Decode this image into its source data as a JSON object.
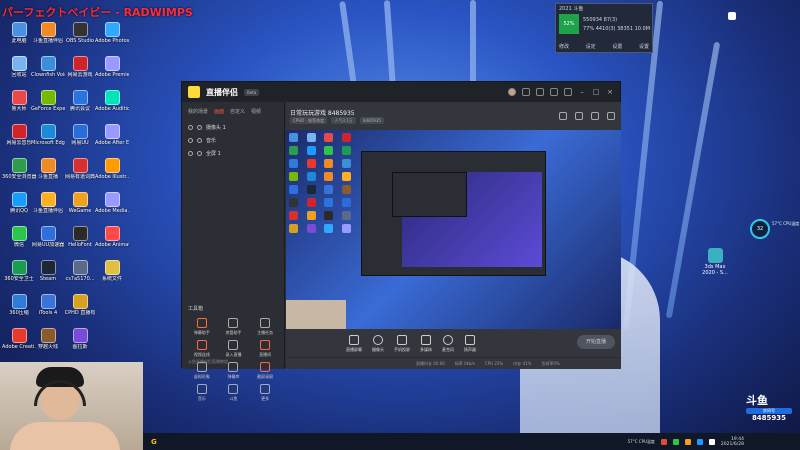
{
  "stream_title": "パーフェクトベイビー - RADWIMPS",
  "desktop_icons_col1": [
    {
      "label": "此电脑",
      "color": "#4a90e2"
    },
    {
      "label": "回收站",
      "color": "#7ab4f0"
    },
    {
      "label": "鲁大师",
      "color": "#e84a4a"
    },
    {
      "label": "网易云音乐",
      "color": "#d0242c"
    },
    {
      "label": "360安全浏览器",
      "color": "#2e9d4b"
    },
    {
      "label": "腾讯QQ",
      "color": "#1a9bff"
    },
    {
      "label": "微信",
      "color": "#2ac54a"
    },
    {
      "label": "360安全卫士",
      "color": "#1c9c50"
    },
    {
      "label": "360压缩",
      "color": "#2f7bd8"
    },
    {
      "label": "Adobe Creati...",
      "color": "#e53a2c"
    }
  ],
  "desktop_icons_col2": [
    {
      "label": "斗鱼直播伴侣",
      "color": "#f08a24"
    },
    {
      "label": "Clownfish Voice...",
      "color": "#3a8fd8"
    },
    {
      "label": "GeForce Experience",
      "color": "#76b900"
    },
    {
      "label": "Microsoft Edge",
      "color": "#1c8ad8"
    },
    {
      "label": "斗鱼直播",
      "color": "#f08a24"
    },
    {
      "label": "斗鱼直播伴侣",
      "color": "#ffb020"
    },
    {
      "label": "网易UU加速器",
      "color": "#2e6fdc"
    },
    {
      "label": "Steam",
      "color": "#1b2838"
    },
    {
      "label": "iTools 4",
      "color": "#3a73d8"
    },
    {
      "label": "穿越火线",
      "color": "#8a5b2c"
    }
  ],
  "desktop_icons_col3": [
    {
      "label": "OBS Studio",
      "color": "#333333"
    },
    {
      "label": "网易云游戏",
      "color": "#d0242c"
    },
    {
      "label": "腾讯会议",
      "color": "#2a74e0"
    },
    {
      "label": "网易UU",
      "color": "#2a6cd8"
    },
    {
      "label": "网易有道词典",
      "color": "#d83030"
    },
    {
      "label": "WeGame",
      "color": "#f0a020"
    },
    {
      "label": "HelloFont",
      "color": "#2a2a2a"
    },
    {
      "label": "cs7a5170...",
      "color": "#5a6a8a"
    },
    {
      "label": "CPHD 直播有",
      "color": "#d8a020"
    },
    {
      "label": "图拉斯",
      "color": "#7a4bd8"
    }
  ],
  "desktop_icons_col4": [
    {
      "label": "Adobe Photosho...",
      "color": "#31a8ff"
    },
    {
      "label": "Adobe Premiere...",
      "color": "#9999ff"
    },
    {
      "label": "Adobe Audition",
      "color": "#00e4bb"
    },
    {
      "label": "Adobe After Eff...",
      "color": "#9999ff"
    },
    {
      "label": "Adobe Illustr...",
      "color": "#ff9a00"
    },
    {
      "label": "Adobe Media...",
      "color": "#9999ff"
    },
    {
      "label": "Adobe Animate",
      "color": "#ff4a4a"
    },
    {
      "label": "系统文件",
      "color": "#e0c040"
    }
  ],
  "net_widget": {
    "header": "2021 斗鱼",
    "badge": "52%",
    "row1": "550934 87(3)",
    "row2": "77% 4410(3)  38351 10.0M",
    "btns": [
      "修改",
      "设定",
      "设置",
      "设置"
    ]
  },
  "app": {
    "name": "直播伴侣",
    "version": "Beta",
    "left_tabs": [
      "我的场景",
      "画面",
      "自定义",
      "视频"
    ],
    "scenes": [
      "摄像头 1",
      "音乐",
      "全屏 1"
    ],
    "tools_header": "工具箱",
    "tools": [
      {
        "label": "弹幕助手",
        "orange": true
      },
      {
        "label": "房管助手",
        "orange": false
      },
      {
        "label": "主播任务",
        "orange": false
      },
      {
        "label": "视频连线",
        "orange": true
      },
      {
        "label": "录入直播",
        "orange": false
      },
      {
        "label": "直播间",
        "orange": true
      },
      {
        "label": "虚拟形象",
        "orange": false
      },
      {
        "label": "弹幕库",
        "orange": false
      },
      {
        "label": "截屏录屏",
        "orange": true
      },
      {
        "label": "音乐",
        "orange": false
      },
      {
        "label": "斗鱼",
        "orange": false
      },
      {
        "label": "更多",
        "orange": false
      }
    ],
    "left_footer": "斗鱼直播伴侣直播教程",
    "room_title": "日常玩玩游戏 8485935",
    "room_tags": [
      "CPHD · 推荐热度",
      "人气3.1万",
      "8485935"
    ],
    "controls": [
      "直播屏幕",
      "摄像头",
      "手机投屏",
      "多媒体",
      "麦克风",
      "扬声器"
    ],
    "go_live": "开始直播",
    "status": [
      "直播时长 00:00",
      "码率 0kb/s",
      "CPU 22%",
      "内存 41%",
      "丢帧率0%"
    ]
  },
  "cpu_gauge": {
    "value": "32",
    "temp": "57°C CPU温度"
  },
  "right_icon": "3ds Max 2020 - S...",
  "douyu": {
    "brand": "斗鱼",
    "room_label": "房间号",
    "room_num": "8485935"
  },
  "taskbar": {
    "app": "G",
    "temp": "57°C CPU温度",
    "time": "19:44",
    "date": "2021/6/28"
  }
}
